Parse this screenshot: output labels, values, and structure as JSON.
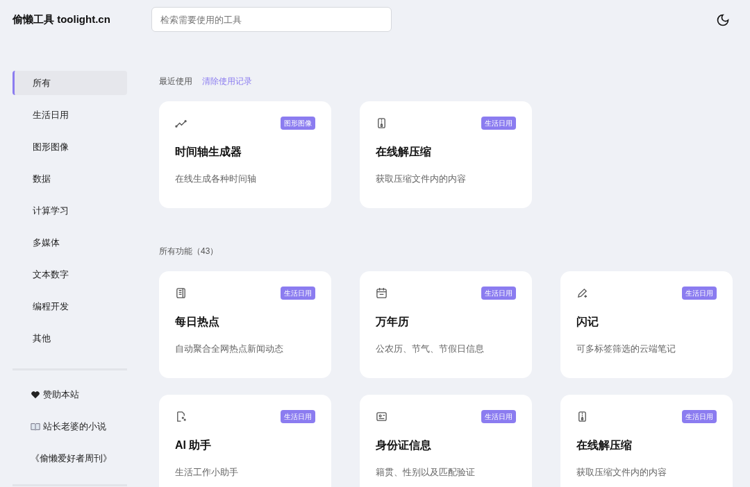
{
  "header": {
    "logo": "偷懒工具 toolight.cn",
    "search": {
      "placeholder": "检索需要使用的工具"
    }
  },
  "sidebar": {
    "items": [
      {
        "label": "所有",
        "selected": true
      },
      {
        "label": "生活日用",
        "selected": false
      },
      {
        "label": "图形图像",
        "selected": false
      },
      {
        "label": "数据",
        "selected": false
      },
      {
        "label": "计算学习",
        "selected": false
      },
      {
        "label": "多媒体",
        "selected": false
      },
      {
        "label": "文本数字",
        "selected": false
      },
      {
        "label": "编程开发",
        "selected": false
      },
      {
        "label": "其他",
        "selected": false
      }
    ],
    "links": [
      {
        "kind": "heart",
        "label": "赞助本站"
      },
      {
        "kind": "book",
        "label": "站长老婆的小说"
      },
      {
        "kind": "plain",
        "label": "《偷懒爱好者周刊》"
      }
    ]
  },
  "recent": {
    "title": "最近使用",
    "clear_link": "清除使用记录",
    "cards": [
      {
        "kind": "chart",
        "tag": "图形图像",
        "title": "时间轴生成器",
        "description": "在线生成各种时间轴"
      },
      {
        "kind": "zip",
        "tag": "生活日用",
        "title": "在线解压缩",
        "description": "获取压缩文件内的内容"
      }
    ]
  },
  "all": {
    "title": "所有功能（43）",
    "cards": [
      {
        "kind": "news",
        "tag": "生活日用",
        "title": "每日热点",
        "description": "自动聚合全网热点新闻动态"
      },
      {
        "kind": "calendar",
        "tag": "生活日用",
        "title": "万年历",
        "description": "公农历、节气、节假日信息"
      },
      {
        "kind": "pen",
        "tag": "生活日用",
        "title": "闪记",
        "description": "可多标签筛选的云端笔记"
      },
      {
        "kind": "ai",
        "tag": "生活日用",
        "title": "AI 助手",
        "description": "生活工作小助手"
      },
      {
        "kind": "idcard",
        "tag": "生活日用",
        "title": "身份证信息",
        "description": "籍贯、性别以及匹配验证"
      },
      {
        "kind": "zip",
        "tag": "生活日用",
        "title": "在线解压缩",
        "description": "获取压缩文件内的内容"
      }
    ]
  }
}
